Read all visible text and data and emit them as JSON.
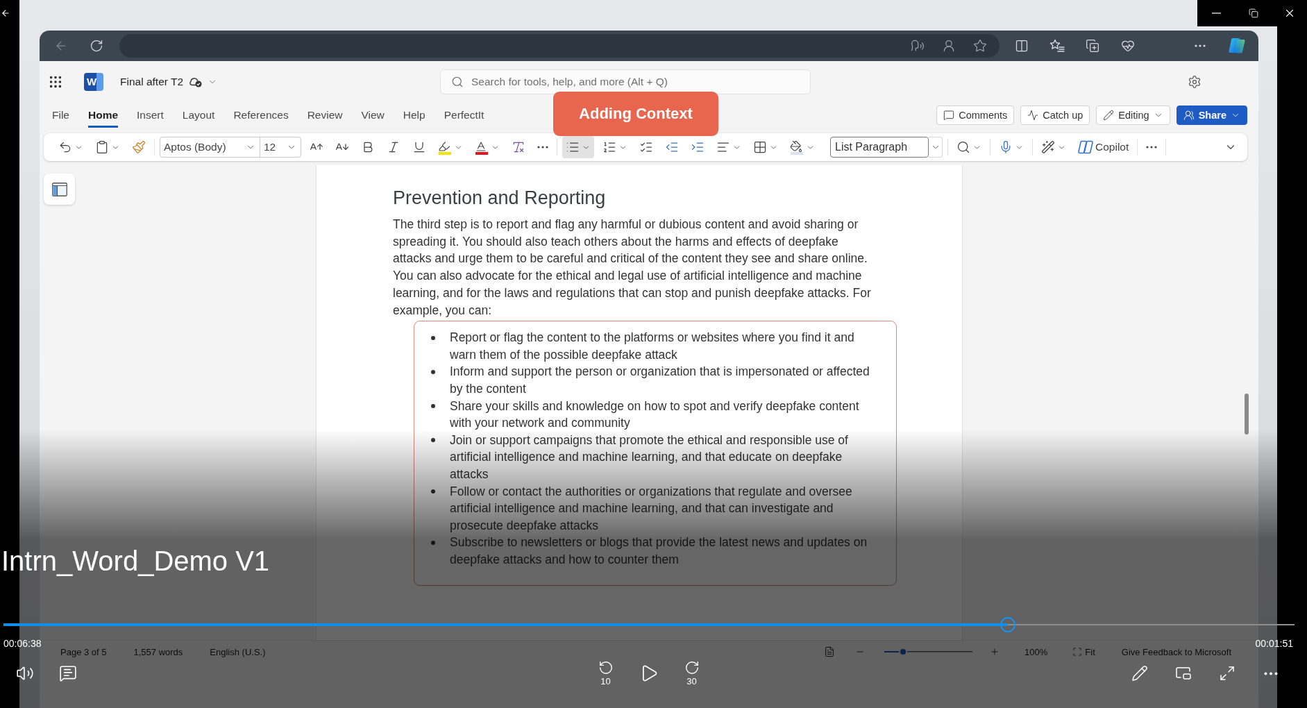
{
  "video": {
    "title": "Intrn_Word_Demo V1",
    "elapsed": "00:06:38",
    "remaining": "00:01:51",
    "progress": {
      "level": 0.778
    },
    "rewind_label": "10",
    "forward_label": "30"
  },
  "word": {
    "app_letter": "W",
    "document_name": "Final after T2",
    "search": {
      "placeholder": "Search for tools, help, and more (Alt + Q)"
    },
    "tabs": [
      {
        "label": "File",
        "selected": false
      },
      {
        "label": "Home",
        "selected": true
      },
      {
        "label": "Insert",
        "selected": false
      },
      {
        "label": "Layout",
        "selected": false
      },
      {
        "label": "References",
        "selected": false
      },
      {
        "label": "Review",
        "selected": false
      },
      {
        "label": "View",
        "selected": false
      },
      {
        "label": "Help",
        "selected": false
      },
      {
        "label": "PerfectIt",
        "selected": false
      }
    ],
    "actions": [
      {
        "label": "Comments",
        "kind": "comments"
      },
      {
        "label": "Catch up",
        "kind": "catch_up"
      },
      {
        "label": "Editing",
        "kind": "mode"
      },
      {
        "label": "Share",
        "kind": "share"
      }
    ],
    "toolbar": {
      "font_name": "Aptos (Body)",
      "font_size": "12",
      "bullets_on": true,
      "style": "List Paragraph",
      "copilot": "Copilot"
    },
    "document": {
      "heading": "Prevention and Reporting",
      "paragraph": "The third step is to report and flag any harmful or dubious content and avoid sharing or spreading it. You should also teach others about the harms and effects of deepfake attacks and urge them to be careful and critical of the content they see and share online. You can also advocate for the ethical and legal use of artificial intelligence and machine learning, and for the laws and regulations that can stop and punish deepfake attacks. For example, you can:",
      "bullets": [
        "Report or flag the content to the platforms or websites where you find it and warn them of the possible deepfake attack",
        "Inform and support the person or organization that is impersonated or affected by the content",
        "Share your skills and knowledge on how to spot and verify deepfake content with your network and community",
        "Join or support campaigns that promote the ethical and responsible use of artificial intelligence and machine learning, and that educate on deepfake attacks",
        "Follow or contact the authorities or organizations that regulate and oversee artificial intelligence and machine learning, and that can investigate and prosecute deepfake attacks",
        "Subscribe to newsletters or blogs that provide the latest news and updates on deepfake attacks and how to counter them"
      ]
    },
    "status_bar": {
      "page": "Page 3 of 5",
      "words": "1,557 words",
      "language": "English (U.S.)",
      "zoom": {
        "level": 0.21
      },
      "zoom_percent": "100%",
      "fit": "Fit",
      "feedback": "Give Feedback to Microsoft"
    }
  },
  "callout": {
    "text": "Adding Context"
  }
}
